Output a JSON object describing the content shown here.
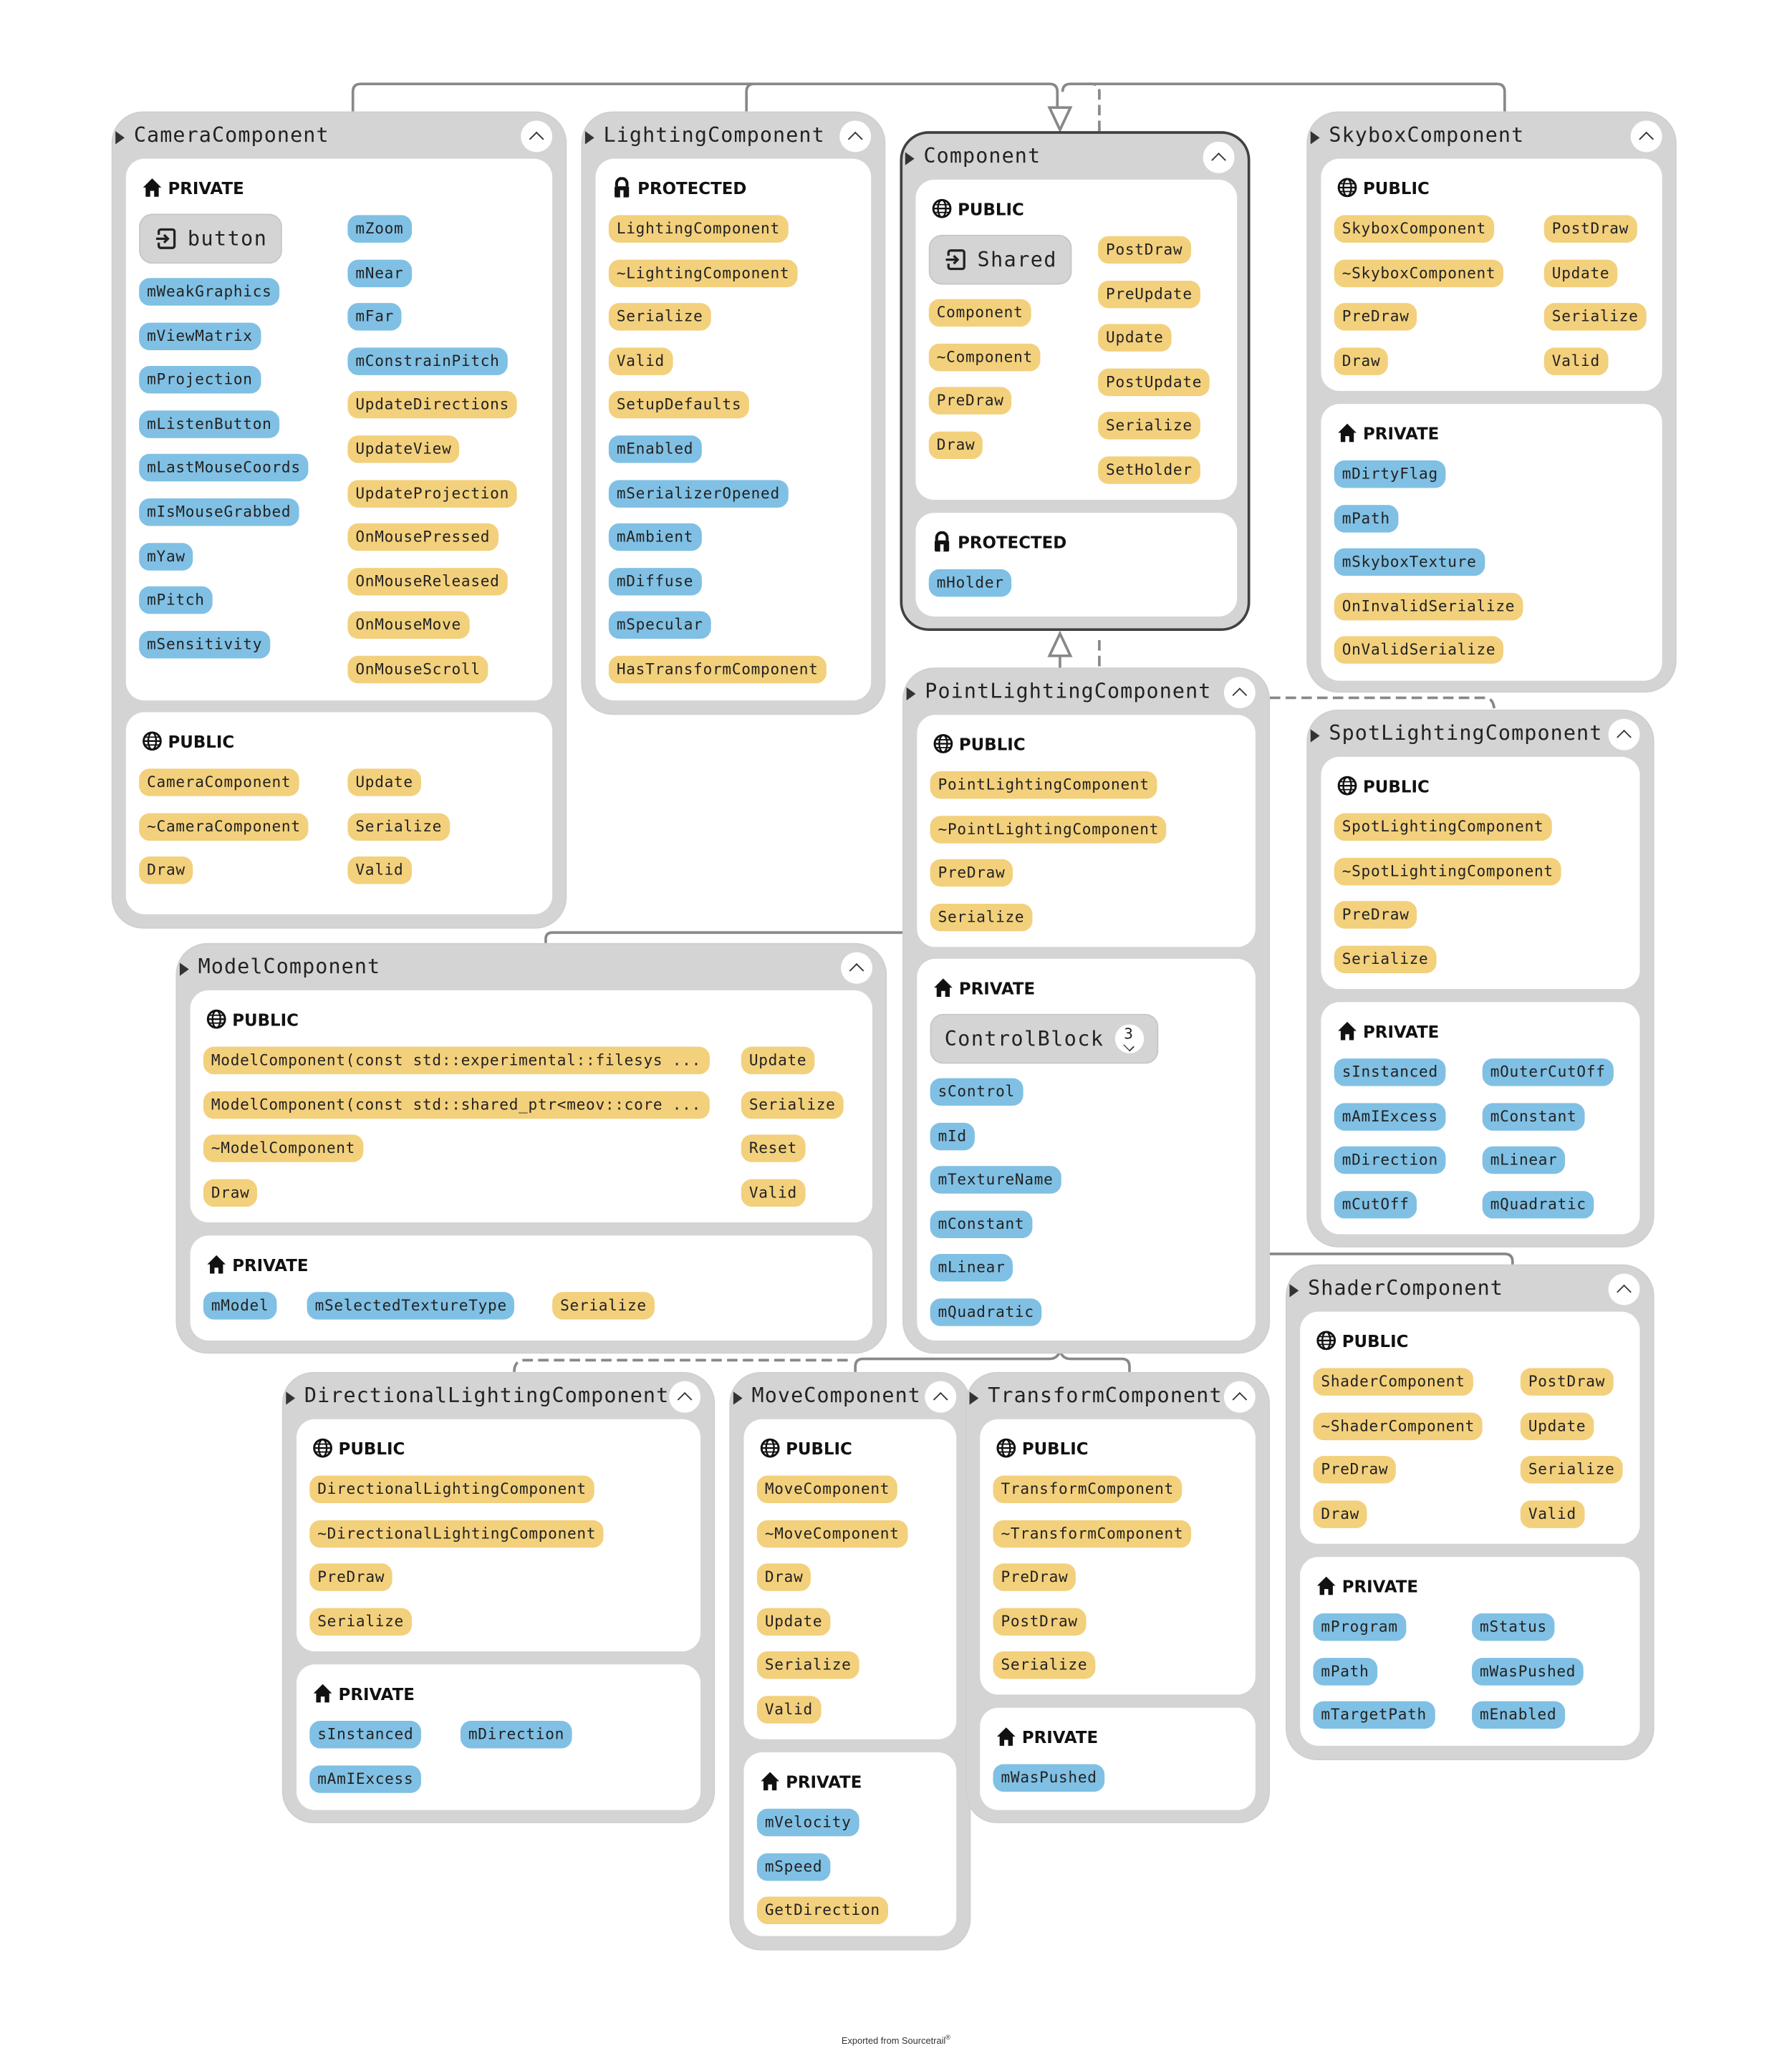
{
  "footer": {
    "text": "Exported from Sourcetrail",
    "mark": "®"
  },
  "colors": {
    "function": "#f3d07c",
    "variable": "#80c0e4",
    "node_bg": "#d4d4d4",
    "edge": "#888888"
  },
  "nodes": {
    "camera": {
      "title": "CameraComponent",
      "private": {
        "label": "PRIVATE",
        "group": "button",
        "col1": [
          "mWeakGraphics",
          "mViewMatrix",
          "mProjection",
          "mListenButton",
          "mLastMouseCoords",
          "mIsMouseGrabbed",
          "mYaw",
          "mPitch",
          "mSensitivity"
        ],
        "col2": [
          "mZoom",
          "mNear",
          "mFar",
          "mConstrainPitch",
          "UpdateDirections",
          "UpdateView",
          "UpdateProjection",
          "OnMousePressed",
          "OnMouseReleased",
          "OnMouseMove",
          "OnMouseScroll"
        ]
      },
      "public": {
        "label": "PUBLIC",
        "col1": [
          "CameraComponent",
          "~CameraComponent",
          "Draw"
        ],
        "col2": [
          "Update",
          "Serialize",
          "Valid"
        ]
      }
    },
    "lighting": {
      "title": "LightingComponent",
      "protected": {
        "label": "PROTECTED",
        "items": [
          "LightingComponent",
          "~LightingComponent",
          "Serialize",
          "Valid",
          "SetupDefaults",
          "mEnabled",
          "mSerializerOpened",
          "mAmbient",
          "mDiffuse",
          "mSpecular",
          "HasTransformComponent"
        ]
      }
    },
    "component": {
      "title": "Component",
      "public": {
        "label": "PUBLIC",
        "group": "Shared",
        "col1": [
          "Component",
          "~Component",
          "PreDraw",
          "Draw"
        ],
        "col2": [
          "PostDraw",
          "PreUpdate",
          "Update",
          "PostUpdate",
          "Serialize",
          "SetHolder"
        ]
      },
      "protected": {
        "label": "PROTECTED",
        "items": [
          "mHolder"
        ]
      }
    },
    "skybox": {
      "title": "SkyboxComponent",
      "public": {
        "label": "PUBLIC",
        "col1": [
          "SkyboxComponent",
          "~SkyboxComponent",
          "PreDraw",
          "Draw"
        ],
        "col2": [
          "PostDraw",
          "Update",
          "Serialize",
          "Valid"
        ]
      },
      "private": {
        "label": "PRIVATE",
        "items": [
          "mDirtyFlag",
          "mPath",
          "mSkyboxTexture",
          "OnInvalidSerialize",
          "OnValidSerialize"
        ]
      }
    },
    "pointlight": {
      "title": "PointLightingComponent",
      "public": {
        "label": "PUBLIC",
        "items": [
          "PointLightingComponent",
          "~PointLightingComponent",
          "PreDraw",
          "Serialize"
        ]
      },
      "private": {
        "label": "PRIVATE",
        "group": "ControlBlock",
        "group_count": "3",
        "items": [
          "sControl",
          "mId",
          "mTextureName",
          "mConstant",
          "mLinear",
          "mQuadratic"
        ]
      }
    },
    "spotlight": {
      "title": "SpotLightingComponent",
      "public": {
        "label": "PUBLIC",
        "items": [
          "SpotLightingComponent",
          "~SpotLightingComponent",
          "PreDraw",
          "Serialize"
        ]
      },
      "private": {
        "label": "PRIVATE",
        "col1": [
          "sInstanced",
          "mAmIExcess",
          "mDirection",
          "mCutOff"
        ],
        "col2": [
          "mOuterCutOff",
          "mConstant",
          "mLinear",
          "mQuadratic"
        ]
      }
    },
    "model": {
      "title": "ModelComponent",
      "public": {
        "label": "PUBLIC",
        "col1": [
          "ModelComponent(const std::experimental::filesys ...",
          "ModelComponent(const std::shared_ptr<meov::core ...",
          "~ModelComponent",
          "Draw"
        ],
        "col2": [
          "Update",
          "Serialize",
          "Reset",
          "Valid"
        ]
      },
      "private": {
        "label": "PRIVATE",
        "items": [
          "mModel",
          "mSelectedTextureType",
          "Serialize"
        ]
      }
    },
    "shader": {
      "title": "ShaderComponent",
      "public": {
        "label": "PUBLIC",
        "col1": [
          "ShaderComponent",
          "~ShaderComponent",
          "PreDraw",
          "Draw"
        ],
        "col2": [
          "PostDraw",
          "Update",
          "Serialize",
          "Valid"
        ]
      },
      "private": {
        "label": "PRIVATE",
        "col1": [
          "mProgram",
          "mPath",
          "mTargetPath"
        ],
        "col2": [
          "mStatus",
          "mWasPushed",
          "mEnabled"
        ]
      }
    },
    "directional": {
      "title": "DirectionalLightingComponent",
      "public": {
        "label": "PUBLIC",
        "items": [
          "DirectionalLightingComponent",
          "~DirectionalLightingComponent",
          "PreDraw",
          "Serialize"
        ]
      },
      "private": {
        "label": "PRIVATE",
        "col1": [
          "sInstanced",
          "mAmIExcess"
        ],
        "col2": [
          "mDirection"
        ]
      }
    },
    "move": {
      "title": "MoveComponent",
      "public": {
        "label": "PUBLIC",
        "items": [
          "MoveComponent",
          "~MoveComponent",
          "Draw",
          "Update",
          "Serialize",
          "Valid"
        ]
      },
      "private": {
        "label": "PRIVATE",
        "items": [
          "mVelocity",
          "mSpeed",
          "GetDirection"
        ]
      }
    },
    "transform": {
      "title": "TransformComponent",
      "public": {
        "label": "PUBLIC",
        "items": [
          "TransformComponent",
          "~TransformComponent",
          "PreDraw",
          "PostDraw",
          "Serialize"
        ]
      },
      "private": {
        "label": "PRIVATE",
        "items": [
          "mWasPushed"
        ]
      }
    }
  }
}
